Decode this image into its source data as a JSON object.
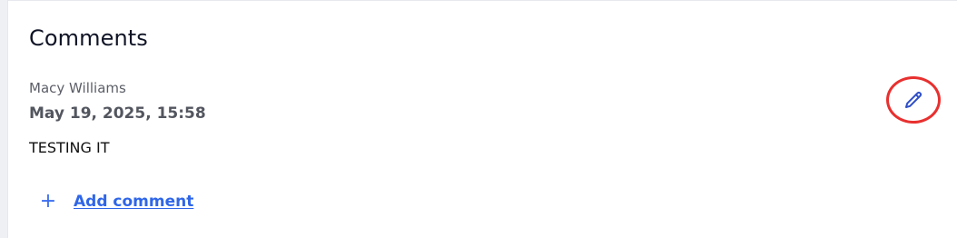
{
  "comments": {
    "title": "Comments",
    "items": [
      {
        "author": "Macy Williams",
        "timestamp": "May 19, 2025, 15:58",
        "text": "TESTING IT"
      }
    ],
    "add_comment_label": "Add comment",
    "add_icon": "plus-icon",
    "edit_icon": "pencil-icon"
  },
  "colors": {
    "accent": "#2f66e8",
    "highlight": "#e8302f"
  }
}
